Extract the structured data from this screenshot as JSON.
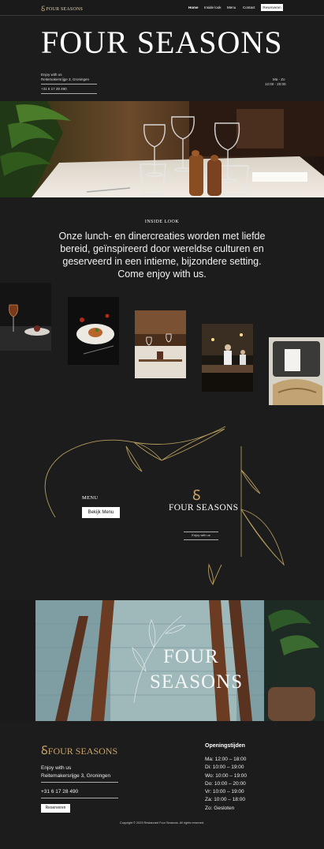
{
  "nav": {
    "logo_text": "FOUR SEASONS",
    "logo_mark": "ꟗ",
    "links": [
      "Home",
      "Inside look",
      "Menu",
      "Contact"
    ],
    "reserve_label": "Reserveren"
  },
  "hero": {
    "title": "FOUR SEASONS",
    "enjoy": "Enjoy with us",
    "address": "Reitemakersrijge 3, Groningen",
    "phone": "+31 6 17 28 490",
    "days": "Ma - Zo",
    "hours": "12:00 - 20:00"
  },
  "inside": {
    "title": "INSIDE LOOK",
    "text": "Onze lunch- en dinercreaties worden met liefde bereid, geïnspireerd door wereldse culturen en geserveerd in een intieme, bijzondere setting. Come enjoy with us."
  },
  "menu": {
    "label": "MENU",
    "button": "Bekijk Menu",
    "logo_text": "FOUR SEASONS",
    "enjoy": "Enjoy with us"
  },
  "banner": {
    "line1": "FOUR",
    "line2": "SEASONS"
  },
  "footer": {
    "logo_text": "FOUR SEASONS",
    "enjoy": "Enjoy with us",
    "address": "Reitemakersrijge 3, Groningen",
    "phone": "+31 6 17 28 490",
    "reserve_label": "Reserveren",
    "hours_title": "Openingstijden",
    "hours": [
      "Ma: 12:00 – 18:00",
      "Di: 10:00 – 19:00",
      "Wo: 10:00 – 19:00",
      "Do: 10:00 – 20:00",
      "Vr: 10:00 – 19:00",
      "Za: 10:00 – 18:00",
      "Zo: Gesloten"
    ],
    "copyright": "Copyright © 2023 Restaurant Four Seasons. All rights reserved."
  },
  "colors": {
    "background": "#1c1c1c",
    "gold": "#c9a46b",
    "line_gold": "#b39a5c"
  }
}
